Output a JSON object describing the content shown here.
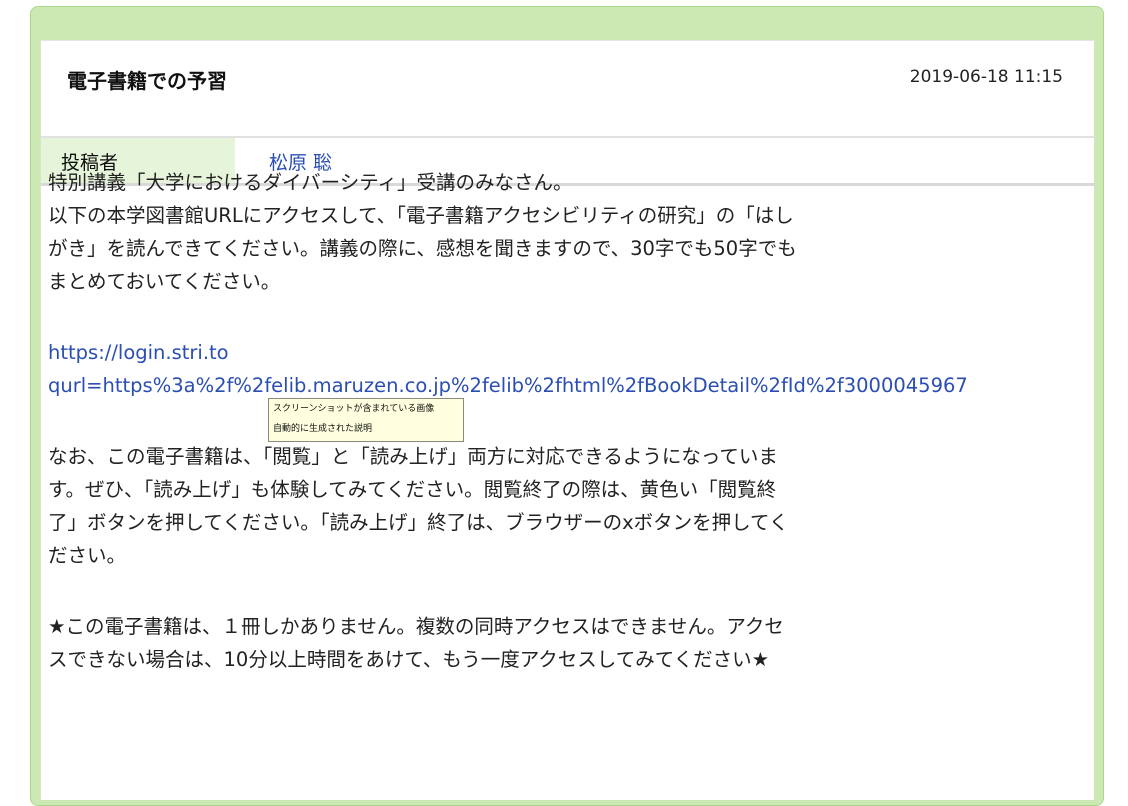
{
  "post": {
    "title": "電子書籍での予習",
    "datetime": "2019-06-18 11:15",
    "author_label": "投稿者",
    "author_name": "松原 聡"
  },
  "body": {
    "para1": "特別講義「大学におけるダイバーシティ」受講のみなさん。\n以下の本学図書館URLにアクセスして、「電子書籍アクセシビリティの研究」の「はし\nがき」を読んできてください。講義の際に、感想を聞きますので、30字でも50字でも\nまとめておいてください。",
    "link": "https://login.stri.to\nqurl=https%3a%2f%2felib.maruzen.co.jp%2felib%2fhtml%2fBookDetail%2fId%2f3000045967",
    "para2": "なお、この電子書籍は、「閲覧」と「読み上げ」両方に対応できるようになっていま\nす。ぜひ、「読み上げ」も体験してみてください。閲覧終了の際は、黄色い「閲覧終\n了」ボタンを押してください。「読み上げ」終了は、ブラウザーのxボタンを押してく\nださい。",
    "para3": "★この電子書籍は、１冊しかありません。複数の同時アクセスはできません。アクセ\nスできない場合は、10分以上時間をあけて、もう一度アクセスしてみてください★"
  },
  "tooltip": {
    "line1": "スクリーンショットが含まれている画像",
    "line2": "自動的に生成された説明"
  }
}
